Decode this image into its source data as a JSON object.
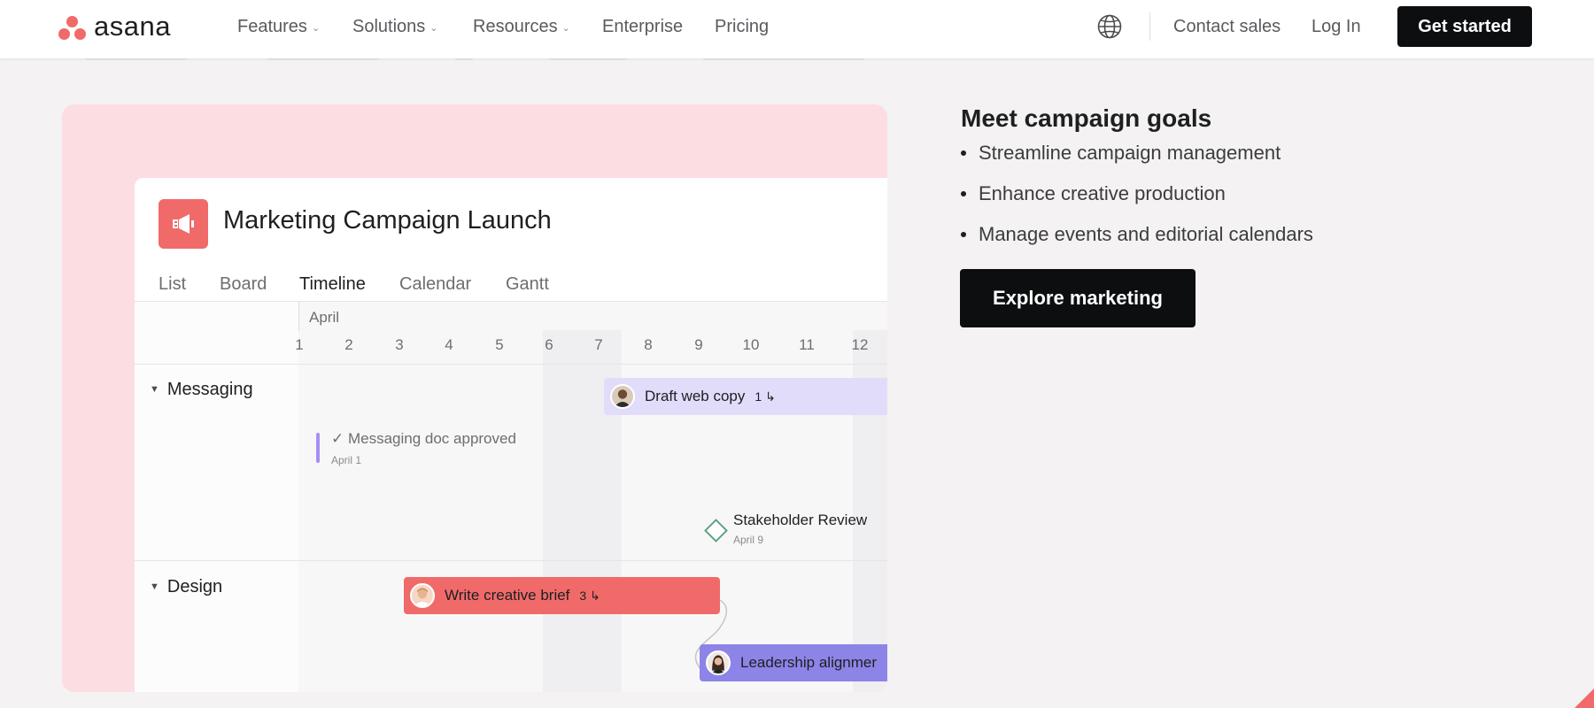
{
  "nav": {
    "brand": "asana",
    "items": [
      {
        "label": "Features",
        "has_dropdown": true
      },
      {
        "label": "Solutions",
        "has_dropdown": true
      },
      {
        "label": "Resources",
        "has_dropdown": true
      },
      {
        "label": "Enterprise",
        "has_dropdown": false
      },
      {
        "label": "Pricing",
        "has_dropdown": false
      }
    ],
    "contact_sales": "Contact sales",
    "log_in": "Log In",
    "get_started": "Get started",
    "icons": {
      "language": "globe-icon",
      "dropdown": "chevron-down-icon"
    }
  },
  "project": {
    "title": "Marketing Campaign Launch",
    "icon": "megaphone-icon",
    "tabs": [
      {
        "label": "List",
        "active": false
      },
      {
        "label": "Board",
        "active": false
      },
      {
        "label": "Timeline",
        "active": true
      },
      {
        "label": "Calendar",
        "active": false
      },
      {
        "label": "Gantt",
        "active": false
      }
    ],
    "month": "April",
    "days": [
      "1",
      "2",
      "3",
      "4",
      "5",
      "6",
      "7",
      "8",
      "9",
      "10",
      "11",
      "12"
    ],
    "sections": [
      {
        "label": "Messaging"
      },
      {
        "label": "Design"
      }
    ],
    "tasks": {
      "draft_web_copy": {
        "title": "Draft web copy",
        "subtasks": "1",
        "color": "#e2dcfb"
      },
      "write_creative_brief": {
        "title": "Write creative brief",
        "subtasks": "3",
        "color": "#f06a6a"
      },
      "leadership_alignment": {
        "title": "Leadership alignmer",
        "color": "#8d84e8"
      }
    },
    "milestones": {
      "messaging_doc": {
        "title": "Messaging doc approved",
        "date": "April 1"
      },
      "stakeholder_review": {
        "title": "Stakeholder Review",
        "date": "April 9"
      }
    }
  },
  "marketing": {
    "heading": "Meet campaign goals",
    "bullets": [
      "Streamline campaign management",
      "Enhance creative production",
      "Manage events and editorial calendars"
    ],
    "cta": "Explore marketing"
  },
  "colors": {
    "brand_coral": "#f06a6a",
    "card_pink": "#fcdde2",
    "button_black": "#0d0e10",
    "milestone_purple": "#a68ef5",
    "milestone_green": "#5da283"
  }
}
